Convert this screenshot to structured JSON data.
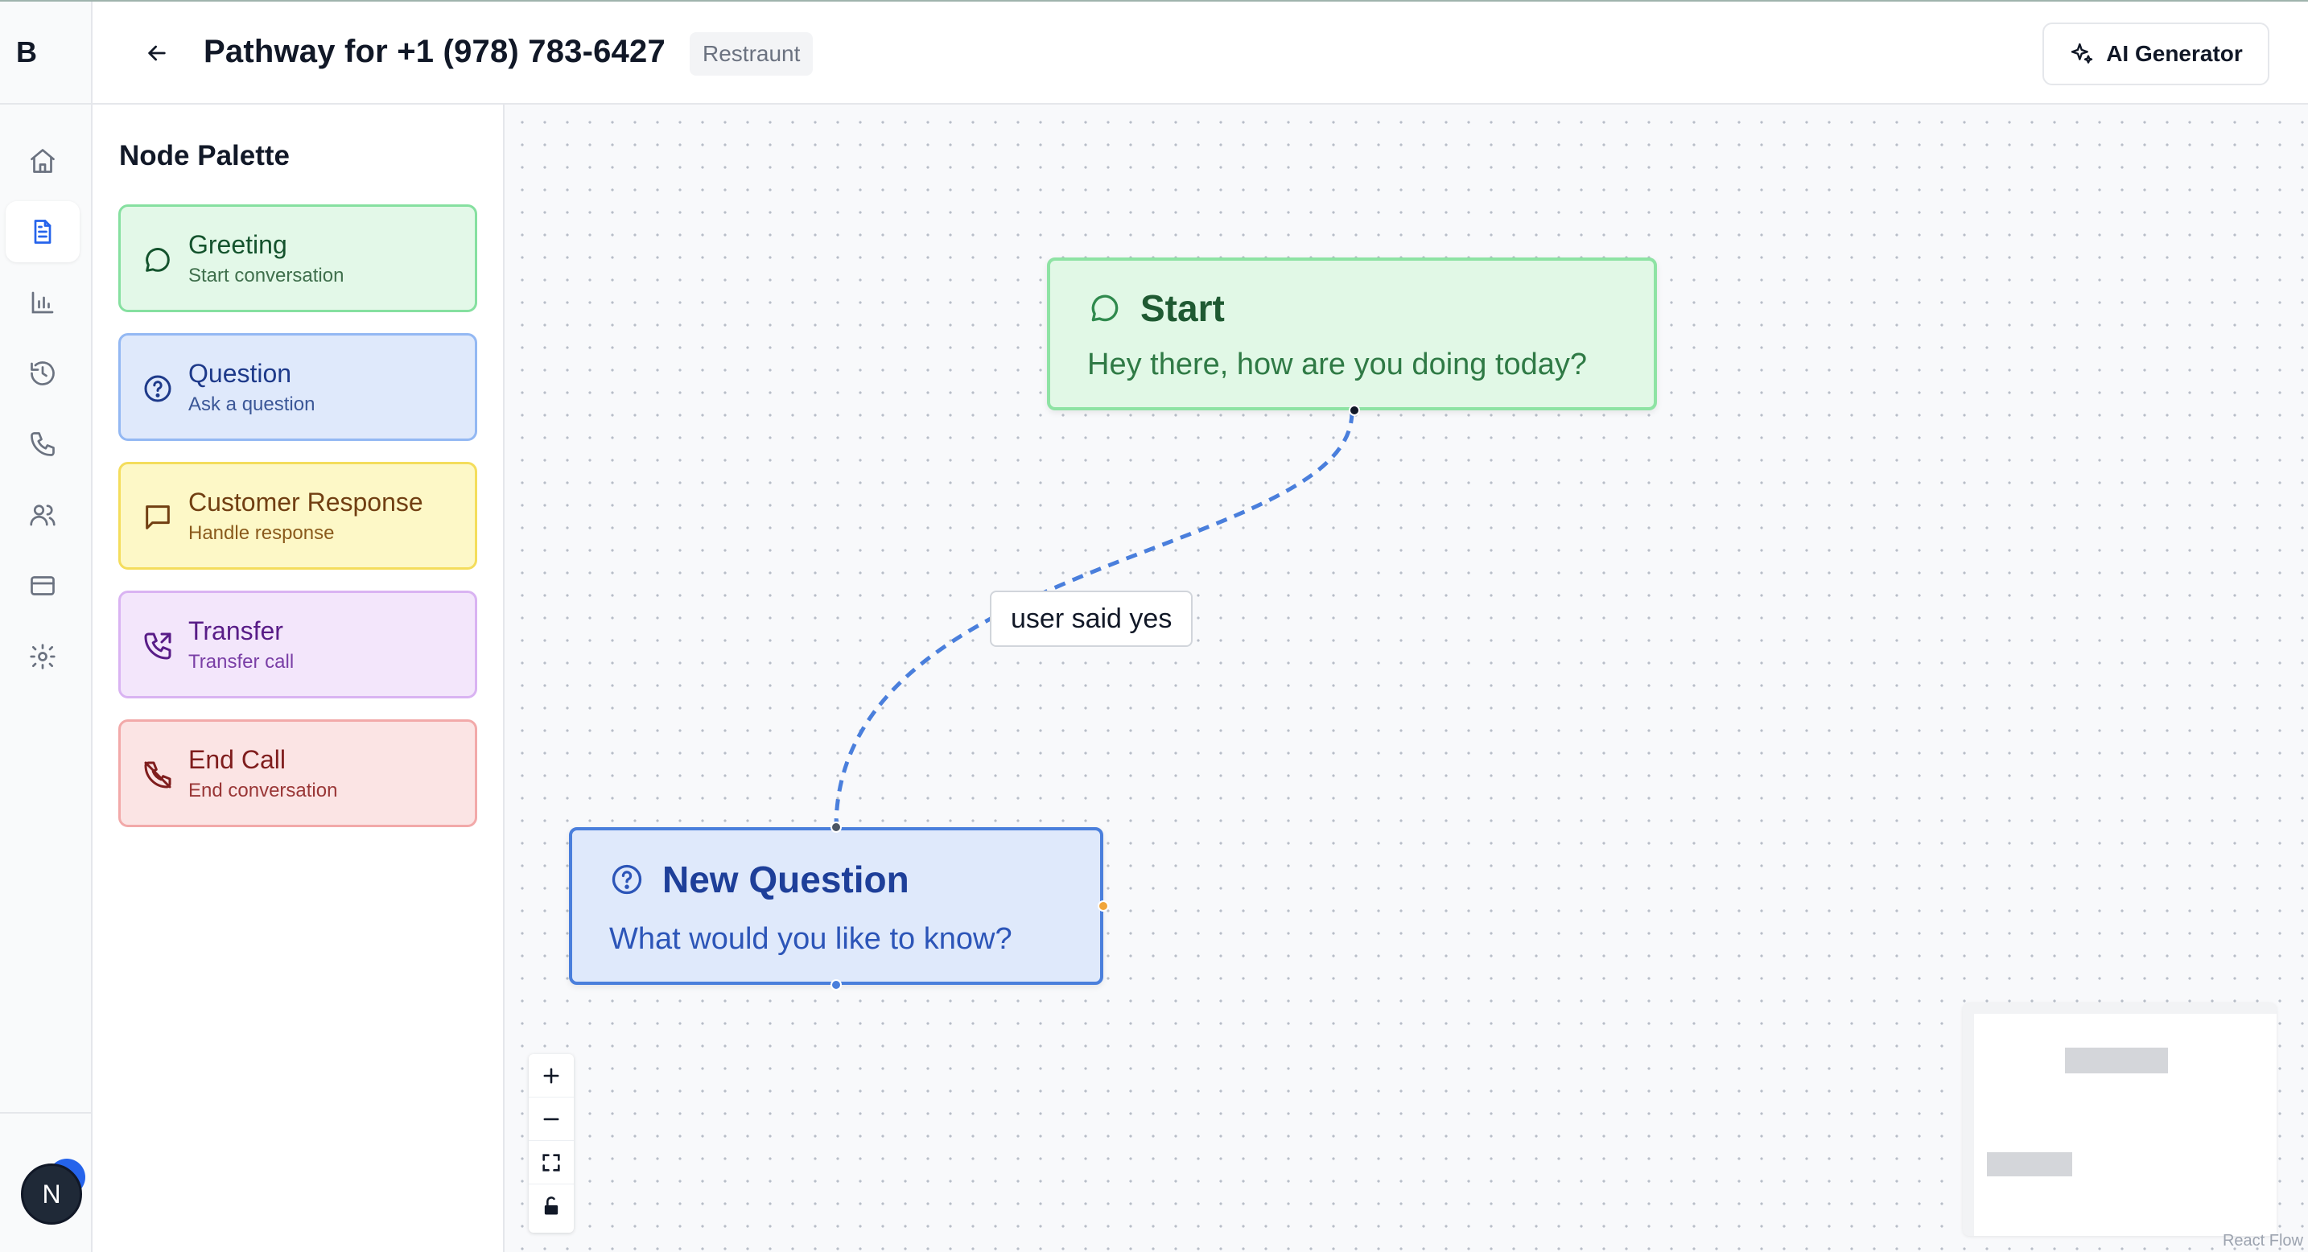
{
  "rail": {
    "logo": "B",
    "items": [
      {
        "icon": "home-icon",
        "active": false
      },
      {
        "icon": "document-icon",
        "active": true
      },
      {
        "icon": "bar-chart-icon",
        "active": false
      },
      {
        "icon": "history-icon",
        "active": false
      },
      {
        "icon": "phone-icon",
        "active": false
      },
      {
        "icon": "users-icon",
        "active": false
      },
      {
        "icon": "credit-card-icon",
        "active": false
      },
      {
        "icon": "gear-icon",
        "active": false
      }
    ],
    "avatar_initial": "N"
  },
  "header": {
    "title": "Pathway for +1 (978) 783-6427",
    "tag": "Restraunt",
    "ai_button_label": "AI Generator"
  },
  "palette": {
    "title": "Node Palette",
    "items": [
      {
        "title": "Greeting",
        "subtitle": "Start conversation",
        "icon": "message-circle-icon"
      },
      {
        "title": "Question",
        "subtitle": "Ask a question",
        "icon": "help-circle-icon"
      },
      {
        "title": "Customer Response",
        "subtitle": "Handle response",
        "icon": "message-square-icon"
      },
      {
        "title": "Transfer",
        "subtitle": "Transfer call",
        "icon": "phone-forward-icon"
      },
      {
        "title": "End Call",
        "subtitle": "End conversation",
        "icon": "phone-off-icon"
      }
    ]
  },
  "canvas": {
    "nodes": [
      {
        "id": "start",
        "title": "Start",
        "message": "Hey there, how are you doing today?"
      },
      {
        "id": "new-question",
        "title": "New Question",
        "message": "What would you like to know?"
      }
    ],
    "edge_label": "user said yes",
    "attribution": "React Flow"
  },
  "colors": {
    "accent": "#2563eb",
    "edge": "#4a7fdc",
    "handle_orange": "#f0a53a"
  }
}
